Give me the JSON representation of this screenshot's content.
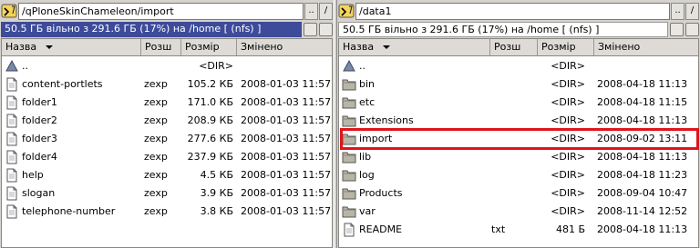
{
  "left": {
    "path": "/qPloneSkinChameleon/import",
    "status": "50.5 ГБ вільно з 291.6 ГБ (17%) на /home [ (nfs) ]",
    "nav_up": "..",
    "nav_root": "/",
    "headers": {
      "name": "Назва",
      "ext": "Розш",
      "size": "Розмір",
      "date": "Змінено"
    },
    "rows": [
      {
        "icon": "up-arrow-icon",
        "name": "..",
        "ext": "",
        "size": "<DIR>",
        "date": ""
      },
      {
        "icon": "file-icon",
        "name": "content-portlets",
        "ext": "zexp",
        "size": "105.2 КБ",
        "date": "2008-01-03 11:57"
      },
      {
        "icon": "file-icon",
        "name": "folder1",
        "ext": "zexp",
        "size": "171.0 КБ",
        "date": "2008-01-03 11:57"
      },
      {
        "icon": "file-icon",
        "name": "folder2",
        "ext": "zexp",
        "size": "208.9 КБ",
        "date": "2008-01-03 11:57"
      },
      {
        "icon": "file-icon",
        "name": "folder3",
        "ext": "zexp",
        "size": "277.6 КБ",
        "date": "2008-01-03 11:57"
      },
      {
        "icon": "file-icon",
        "name": "folder4",
        "ext": "zexp",
        "size": "237.9 КБ",
        "date": "2008-01-03 11:57"
      },
      {
        "icon": "file-icon",
        "name": "help",
        "ext": "zexp",
        "size": "4.5 КБ",
        "date": "2008-01-03 11:57"
      },
      {
        "icon": "file-icon",
        "name": "slogan",
        "ext": "zexp",
        "size": "3.9 КБ",
        "date": "2008-01-03 11:57"
      },
      {
        "icon": "file-icon",
        "name": "telephone-number",
        "ext": "zexp",
        "size": "3.8 КБ",
        "date": "2008-01-03 11:57"
      }
    ]
  },
  "right": {
    "path": "/data1",
    "status": "50.5 ГБ вільно з 291.6 ГБ (17%) на /home [ (nfs) ]",
    "nav_up": "..",
    "nav_root": "/",
    "headers": {
      "name": "Назва",
      "ext": "Розш",
      "size": "Розмір",
      "date": "Змінено"
    },
    "rows": [
      {
        "icon": "up-arrow-icon",
        "name": "..",
        "ext": "",
        "size": "<DIR>",
        "date": ""
      },
      {
        "icon": "folder-icon",
        "name": "bin",
        "ext": "",
        "size": "<DIR>",
        "date": "2008-04-18 11:13"
      },
      {
        "icon": "folder-icon",
        "name": "etc",
        "ext": "",
        "size": "<DIR>",
        "date": "2008-04-18 11:15"
      },
      {
        "icon": "folder-icon",
        "name": "Extensions",
        "ext": "",
        "size": "<DIR>",
        "date": "2008-04-18 11:13"
      },
      {
        "icon": "folder-icon",
        "name": "import",
        "ext": "",
        "size": "<DIR>",
        "date": "2008-09-02 13:11"
      },
      {
        "icon": "folder-icon",
        "name": "lib",
        "ext": "",
        "size": "<DIR>",
        "date": "2008-04-18 11:13"
      },
      {
        "icon": "folder-icon",
        "name": "log",
        "ext": "",
        "size": "<DIR>",
        "date": "2008-04-18 11:23"
      },
      {
        "icon": "folder-icon",
        "name": "Products",
        "ext": "",
        "size": "<DIR>",
        "date": "2008-09-04 10:47"
      },
      {
        "icon": "folder-icon",
        "name": "var",
        "ext": "",
        "size": "<DIR>",
        "date": "2008-11-14 12:52"
      },
      {
        "icon": "file-icon",
        "name": "README",
        "ext": "txt",
        "size": "481 Б",
        "date": "2008-04-18 11:13"
      }
    ]
  },
  "colors": {
    "active_status": "#3d4b9a",
    "highlight": "#e0141a"
  }
}
